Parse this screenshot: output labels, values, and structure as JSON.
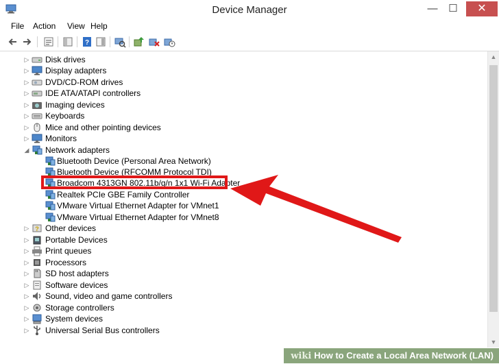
{
  "window": {
    "title": "Device Manager",
    "minimize": "—",
    "maximize": "☐",
    "close": "✕"
  },
  "menu": [
    "File",
    "Action",
    "View",
    "Help"
  ],
  "toolbar": [
    "back-icon",
    "forward-icon",
    "properties-icon",
    "show-hide-tree-icon",
    "help-icon",
    "action-pane-icon",
    "scan-hardware-icon",
    "update-driver-icon",
    "uninstall-icon",
    "disable-icon"
  ],
  "tree": {
    "expand_glyph": "▷",
    "collapse_glyph": "◢",
    "categories_top": [
      "Disk drives",
      "Display adapters",
      "DVD/CD-ROM drives",
      "IDE ATA/ATAPI controllers",
      "Imaging devices",
      "Keyboards",
      "Mice and other pointing devices",
      "Monitors"
    ],
    "network": {
      "label": "Network adapters",
      "children": [
        "Bluetooth Device (Personal Area Network)",
        "Bluetooth Device (RFCOMM Protocol TDI)",
        "Broadcom 4313GN 802.11b/g/n 1x1 Wi-Fi Adapter",
        "Realtek PCIe GBE Family Controller",
        "VMware Virtual Ethernet Adapter for VMnet1",
        "VMware Virtual Ethernet Adapter for VMnet8"
      ]
    },
    "categories_bottom": [
      "Other devices",
      "Portable Devices",
      "Print queues",
      "Processors",
      "SD host adapters",
      "Software devices",
      "Sound, video and game controllers",
      "Storage controllers",
      "System devices",
      "Universal Serial Bus controllers"
    ]
  },
  "annotation": {
    "highlight_color": "#e01818",
    "highlighted_item": "Broadcom 4313GN 802.11b/g/n 1x1 Wi-Fi Adapter"
  },
  "wikihow": {
    "logo": "wiki",
    "title": "How to Create a Local Area Network (LAN)"
  }
}
